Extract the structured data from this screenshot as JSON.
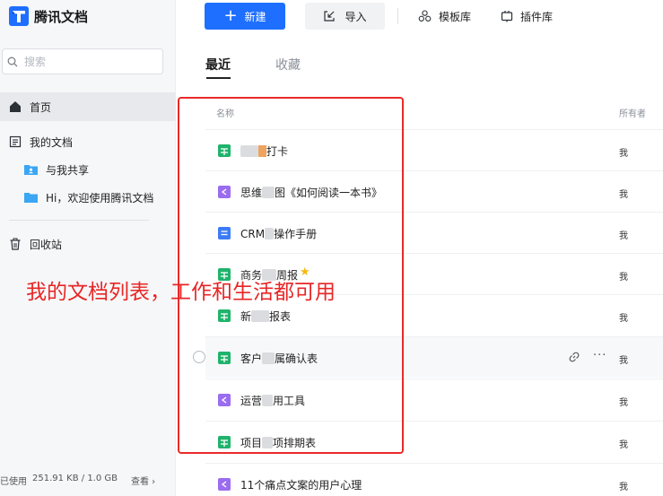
{
  "app": {
    "name": "腾讯文档"
  },
  "search": {
    "placeholder": "搜索"
  },
  "sidebar": {
    "home": "首页",
    "my_docs": "我的文档",
    "shared_with_me": "与我共享",
    "welcome_folder": "Hi，欢迎使用腾讯文档",
    "trash": "回收站"
  },
  "storage": {
    "label": "已使用",
    "value": "251.91 KB / 1.0 GB",
    "view": "查看 ›"
  },
  "toolbar": {
    "new_label": "新建",
    "import_label": "导入",
    "templates_label": "模板库",
    "plugins_label": "插件库"
  },
  "tabs": {
    "recent": "最近",
    "favorites": "收藏"
  },
  "table": {
    "col_name": "名称",
    "col_owner": "所有者"
  },
  "files": [
    {
      "type": "sheet",
      "pre": "",
      "post": "打卡",
      "owner": "我"
    },
    {
      "type": "mindmap",
      "pre": "思维",
      "post": "图《如何阅读一本书》",
      "owner": "我"
    },
    {
      "type": "doc",
      "pre": "CRM",
      "post": "操作手册",
      "owner": "我"
    },
    {
      "type": "sheet",
      "pre": "商务",
      "post": "周报",
      "owner": "我"
    },
    {
      "type": "sheet",
      "pre": "新",
      "post": "报表",
      "owner": "我"
    },
    {
      "type": "sheet",
      "pre": "客户",
      "post": "属确认表",
      "owner": "我"
    },
    {
      "type": "mindmap",
      "pre": "运营",
      "post": "用工具",
      "owner": "我"
    },
    {
      "type": "sheet",
      "pre": "项目",
      "post": "项排期表",
      "owner": "我"
    },
    {
      "type": "mindmap",
      "pre": "11个痛点文案的用户心理",
      "post": "",
      "owner": "我"
    }
  ],
  "annotation": {
    "text": "我的文档列表，工作和生活都可用"
  },
  "colors": {
    "accent": "#1e6fff",
    "sheet": "#1fb36b",
    "mindmap": "#9b6bf0",
    "doc": "#3b7cf6",
    "annotation": "#e82626"
  }
}
